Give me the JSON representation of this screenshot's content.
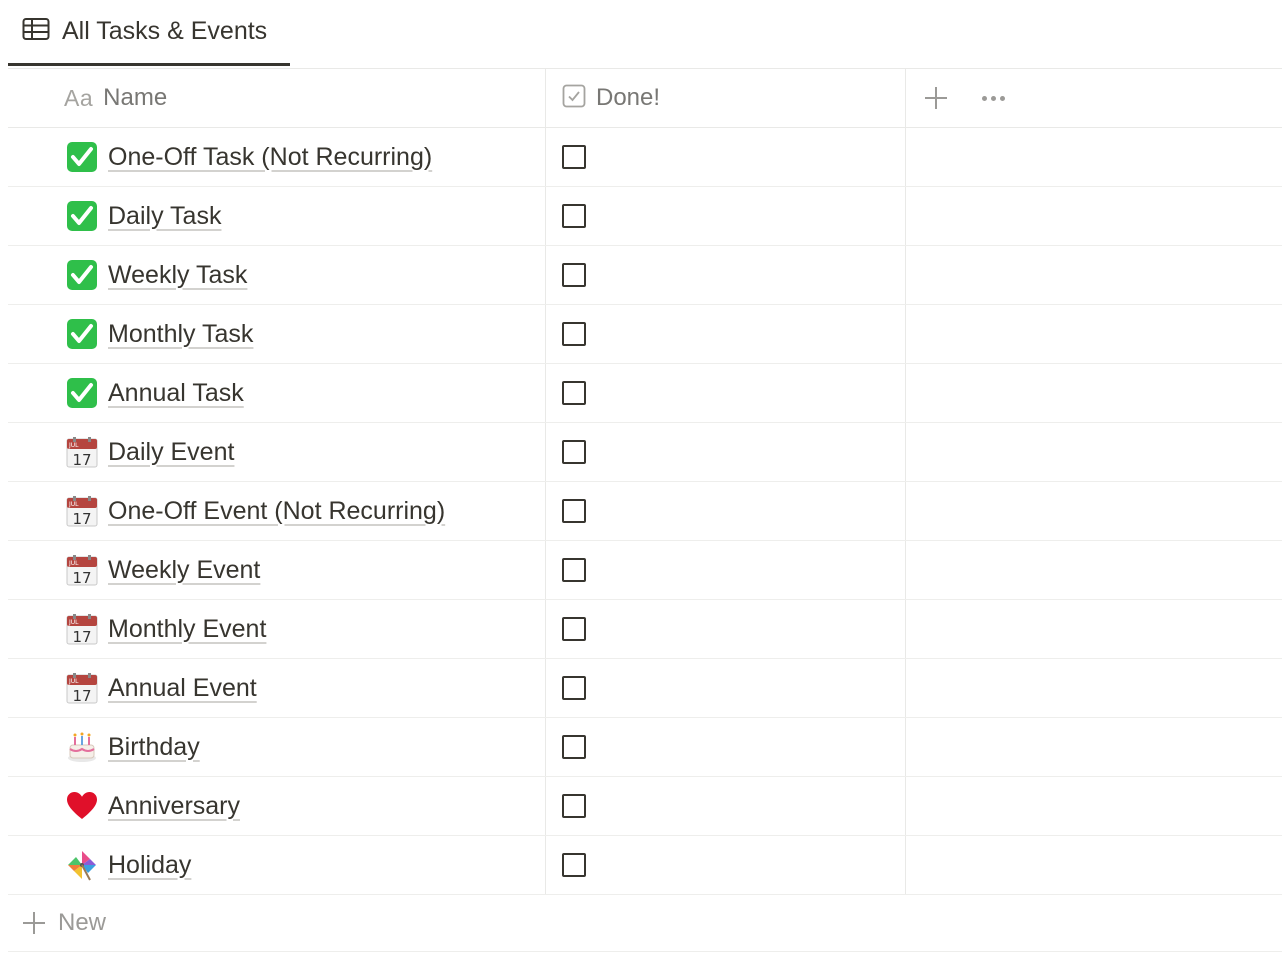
{
  "view": {
    "tab_label": "All Tasks & Events",
    "tab_icon": "table-icon"
  },
  "columns": {
    "name_icon": "Aa",
    "name_label": "Name",
    "done_label": "Done!",
    "add_icon": "plus-icon",
    "more_icon": "more-dots-icon"
  },
  "rows": [
    {
      "title": "One-Off Task (Not Recurring)",
      "icon": "check-mark-button-icon",
      "done": false
    },
    {
      "title": "Daily Task",
      "icon": "check-mark-button-icon",
      "done": false
    },
    {
      "title": "Weekly Task",
      "icon": "check-mark-button-icon",
      "done": false
    },
    {
      "title": "Monthly Task",
      "icon": "check-mark-button-icon",
      "done": false
    },
    {
      "title": "Annual Task",
      "icon": "check-mark-button-icon",
      "done": false
    },
    {
      "title": "Daily Event",
      "icon": "calendar-icon",
      "done": false
    },
    {
      "title": "One-Off Event (Not Recurring)",
      "icon": "calendar-icon",
      "done": false
    },
    {
      "title": "Weekly Event",
      "icon": "calendar-icon",
      "done": false
    },
    {
      "title": "Monthly Event",
      "icon": "calendar-icon",
      "done": false
    },
    {
      "title": "Annual Event",
      "icon": "calendar-icon",
      "done": false
    },
    {
      "title": "Birthday",
      "icon": "birthday-cake-icon",
      "done": false
    },
    {
      "title": "Anniversary",
      "icon": "heart-icon",
      "done": false
    },
    {
      "title": "Holiday",
      "icon": "pinwheel-icon",
      "done": false
    }
  ],
  "calendar_icon_text": {
    "month": "JUL",
    "day": "17"
  },
  "footer": {
    "new_label": "New"
  },
  "colors": {
    "text": "#37352f",
    "muted": "#787774",
    "border": "#e9e9e7",
    "check_green": "#2fbf4a",
    "calendar_red": "#b5453f",
    "heart_red": "#e0102a"
  }
}
